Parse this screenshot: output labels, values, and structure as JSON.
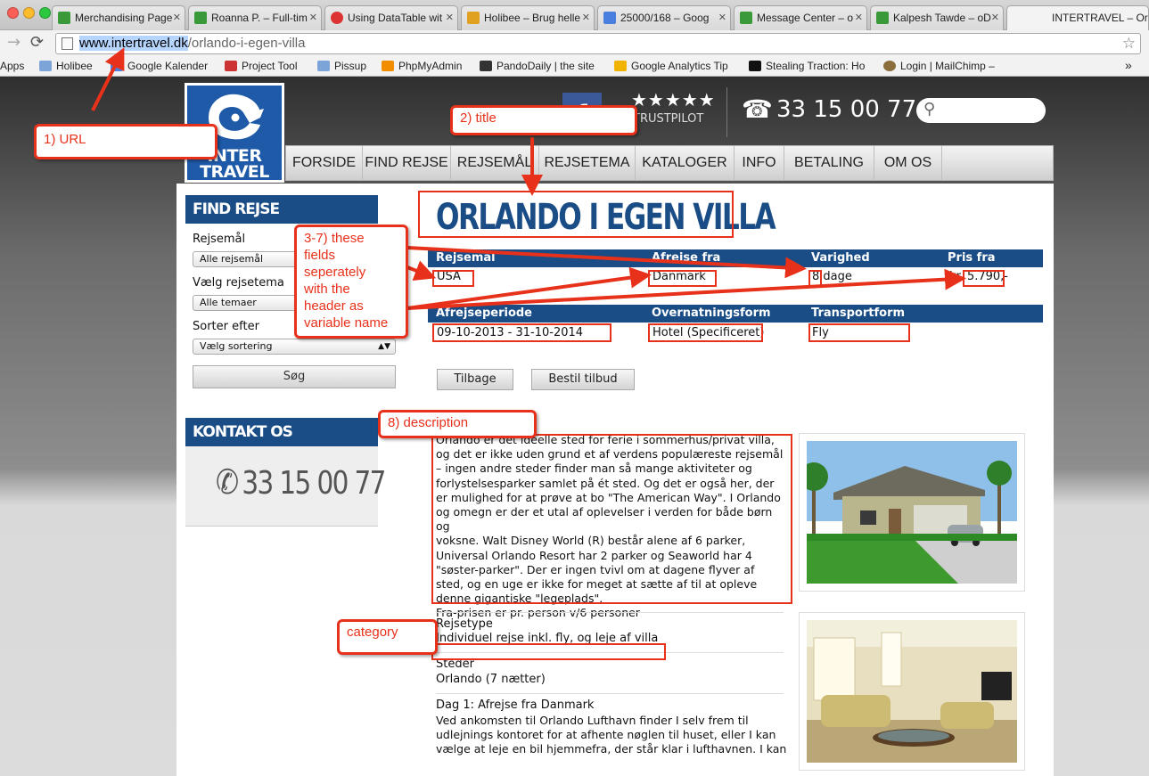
{
  "browser": {
    "tabs": [
      {
        "label": "Merchandising Page",
        "color": "#3a9a3a"
      },
      {
        "label": "Roanna P. – Full-tim",
        "color": "#3a9a3a"
      },
      {
        "label": "Using DataTable wit",
        "color": "#d33"
      },
      {
        "label": "Holibee – Brug helle",
        "color": "#e0a020"
      },
      {
        "label": "25000/168 – Goog",
        "color": "#4a7fe0"
      },
      {
        "label": "Message Center – o",
        "color": "#3a9a3a"
      },
      {
        "label": "Kalpesh Tawde – oD",
        "color": "#3a9a3a"
      },
      {
        "label": "INTERTRAVEL – Orla",
        "color": "#ffffff"
      }
    ],
    "url_host": "www.intertravel.dk",
    "url_path": "/orlando-i-egen-villa",
    "bookmarks": [
      {
        "label": "Apps",
        "icon": "apps-icon"
      },
      {
        "label": "Holibee",
        "icon": "folder-icon"
      },
      {
        "label": "Google Kalender",
        "icon": "calendar-icon"
      },
      {
        "label": "Project Tool",
        "icon": "project-icon"
      },
      {
        "label": "Pissup",
        "icon": "folder-icon"
      },
      {
        "label": "PhpMyAdmin",
        "icon": "phpmyadmin-icon"
      },
      {
        "label": "PandoDaily | the site",
        "icon": "pando-icon"
      },
      {
        "label": "Google Analytics Tip",
        "icon": "analytics-icon"
      },
      {
        "label": "Stealing Traction: Ho",
        "icon": "medium-icon"
      },
      {
        "label": "Login | MailChimp –",
        "icon": "mailchimp-icon"
      }
    ],
    "bookmarks_overflow": "»"
  },
  "site": {
    "logo_text": "INTER TRAVEL",
    "facebook": "f",
    "stars": "★★★★★",
    "trustpilot": "TRUSTPILOT",
    "header_phone": "33 15 00 77",
    "nav": [
      "FORSIDE",
      "FIND REJSE",
      "REJSEMÅL",
      "REJSETEMA",
      "KATALOGER",
      "INFO",
      "BETALING",
      "OM OS"
    ]
  },
  "sidebar": {
    "find_title": "FIND REJSE",
    "destination_label": "Rejsemål",
    "destination_value": "Alle rejsemål",
    "theme_label": "Vælg rejsetema",
    "theme_value": "Alle temaer",
    "sort_label": "Sorter efter",
    "sort_value": "Vælg sortering",
    "search_button": "Søg",
    "contact_title": "KONTAKT OS",
    "contact_phone": "33 15 00 77"
  },
  "trip": {
    "title": "ORLANDO I EGEN VILLA",
    "row1": [
      {
        "header": "Rejsemål",
        "value": "USA"
      },
      {
        "header": "Afrejse fra",
        "value": "Danmark"
      },
      {
        "header": "Varighed",
        "value": "8 dage"
      },
      {
        "header": "Pris fra",
        "value": "kr. 5.790,-"
      }
    ],
    "row2": [
      {
        "header": "Afrejseperiode",
        "value": "09-10-2013 - 31-10-2014"
      },
      {
        "header": "Overnatningsform",
        "value": "Hotel (Specificeret)"
      },
      {
        "header": "Transportform",
        "value": "Fly"
      }
    ],
    "back_button": "Tilbage",
    "order_button": "Bestil tilbud",
    "description_lines": [
      "Orlando er det ideelle sted for ferie i sommerhus/privat villa,",
      "og det er ikke uden grund et af verdens populæreste rejsemål",
      "– ingen andre steder finder man så mange aktiviteter og",
      "forlystelsesparker samlet på ét sted. Og det er også her, der",
      "er mulighed for at prøve at bo \"The American Way\". I Orlando",
      "og omegn er der et utal af oplevelser i verden for både børn og",
      "voksne. Walt Disney World (R) består alene af 6 parker,",
      "Universal Orlando Resort har 2 parker og Seaworld har 4",
      "\"søster-parker\". Der er ingen tvivl om at dagene flyver af",
      "sted, og en uge er ikke for meget at sætte af til at opleve",
      "denne gigantiske \"legeplads\".",
      "Fra-prisen er pr. person v/6 personer"
    ],
    "type_label": "Rejsetype",
    "type_value": "Individuel rejse inkl. fly, og leje af villa",
    "places_label": "Steder",
    "places_value": "Orlando (7 nætter)",
    "day1_title": "Dag 1: Afrejse fra Danmark",
    "day1_lines": [
      "Ved ankomsten til Orlando Lufthavn finder I selv frem til",
      "udlejnings kontoret for at afhente nøglen til huset, eller I kan",
      "vælge at leje en bil hjemmefra, der står klar i lufthavnen. I kan"
    ]
  },
  "annotations": {
    "url": "1) URL",
    "title": "2) title",
    "fields": [
      "3-7) these",
      "fields",
      "seperately",
      "with the",
      "header as",
      "variable name"
    ],
    "description": "8) description",
    "category": "category"
  },
  "colors": {
    "brand_blue": "#1a4c86",
    "annotation_red": "#e8311a"
  }
}
